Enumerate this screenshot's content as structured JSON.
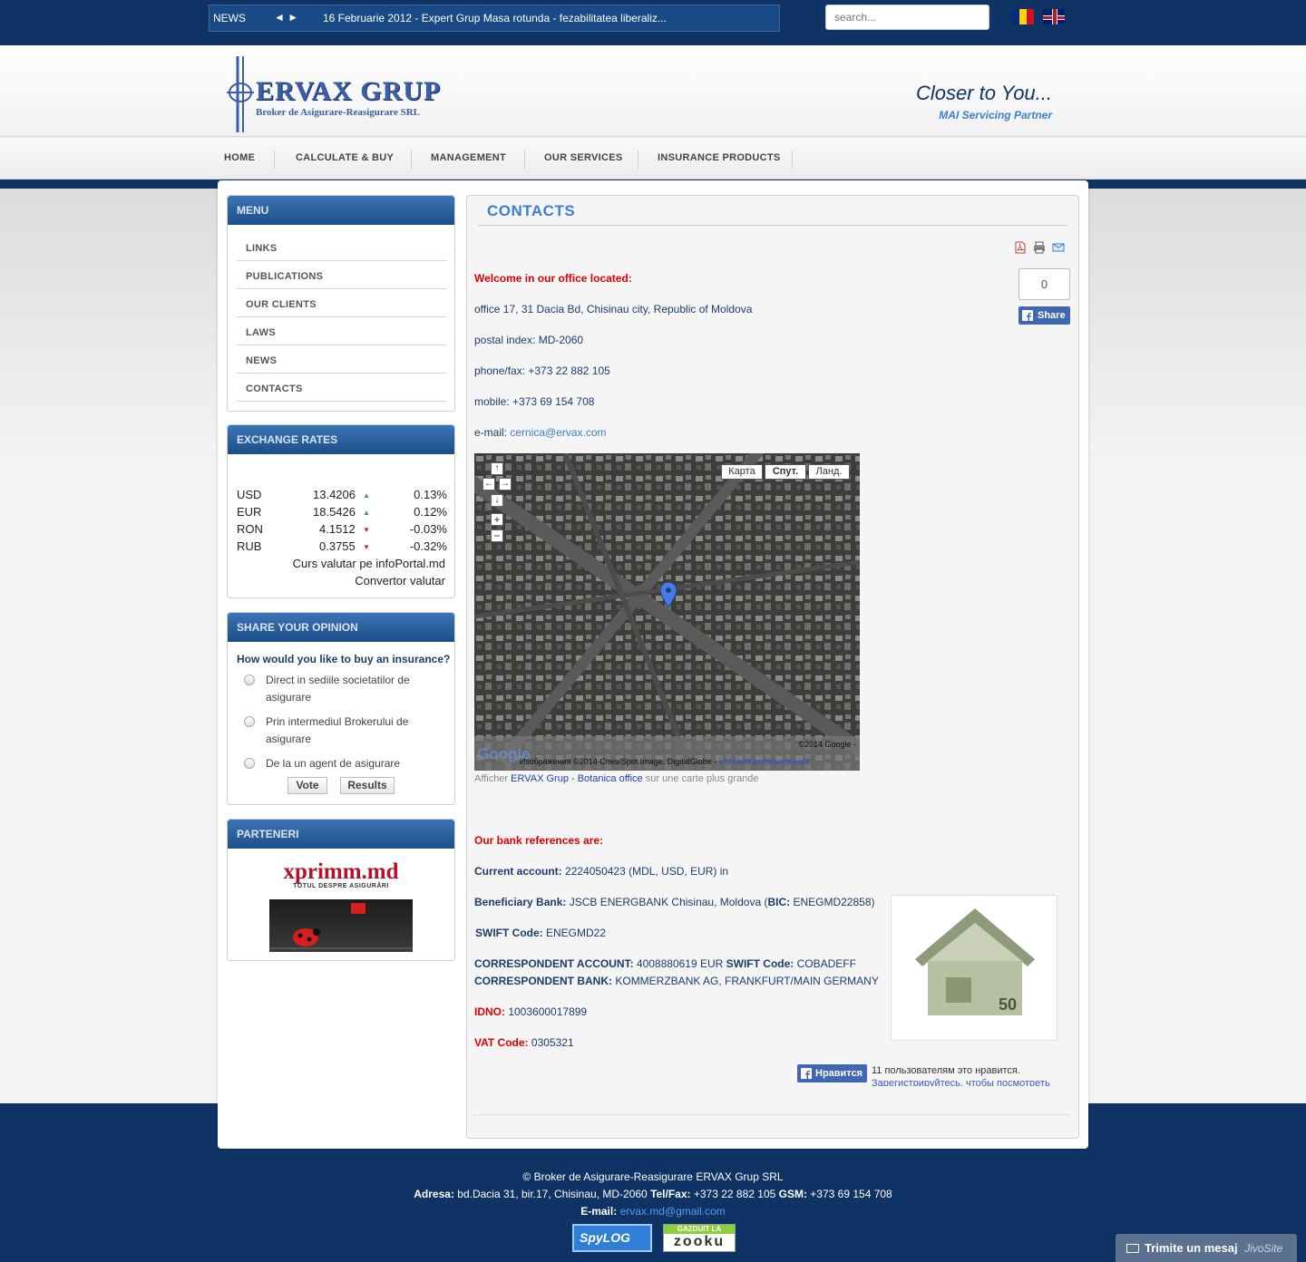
{
  "topbar": {
    "news_label": "NEWS",
    "news_arrows": "◄ ►",
    "news_text": "16 Februarie 2012 - Expert Grup Masa rotunda - fezabilitatea liberaliz...",
    "search_placeholder": "search..."
  },
  "header": {
    "logo_name": "ERVAX GRUP",
    "logo_sub": "Broker de Asigurare-Reasigurare SRL",
    "tagline": "Closer to You...",
    "tagline_sub": "MAI Servicing Partner"
  },
  "nav": [
    "HOME",
    "CALCULATE & BUY",
    "MANAGEMENT",
    "OUR SERVICES",
    "INSURANCE PRODUCTS"
  ],
  "sidebar": {
    "menu_title": "MENU",
    "menu_items": [
      "LINKS",
      "PUBLICATIONS",
      "OUR CLIENTS",
      "LAWS",
      "NEWS",
      "CONTACTS"
    ],
    "rates_title": "EXCHANGE RATES",
    "rates": [
      {
        "code": "USD",
        "value": "13.4206",
        "dir": "▲",
        "change": "0.13%"
      },
      {
        "code": "EUR",
        "value": "18.5426",
        "dir": "▲",
        "change": "0.12%"
      },
      {
        "code": "RON",
        "value": "4.1512",
        "dir": "▼",
        "change": "-0.03%"
      },
      {
        "code": "RUB",
        "value": "0.3755",
        "dir": "▼",
        "change": "-0.32%"
      }
    ],
    "rates_source": "Curs valutar pe infoPortal.md",
    "rates_converter": "Convertor valutar",
    "poll_title": "SHARE YOUR OPINION",
    "poll_question": "How would you like to buy an insurance?",
    "poll_options": [
      "Direct in sediile societatilor de asigurare",
      "Prin intermediul Brokerului de asigurare",
      "De la un agent de asigurare"
    ],
    "vote_label": "Vote",
    "results_label": "Results",
    "partners_title": "PARTENERI",
    "partner1": "xprimm.md",
    "partner1_sub": "TOTUL DESPRE ASIGURĂRI"
  },
  "content": {
    "title": "CONTACTS",
    "share_count": "0",
    "share_label": "Share",
    "welcome": "Welcome in our office located:",
    "address": "office 17, 31 Dacia Bd, Chisinau city, Republic of Moldova",
    "postal": "postal index: MD-2060",
    "phone": "phone/fax: +373 22 882 105",
    "mobile": "mobile: +373 69 154 708",
    "email_label": "e-mail: ",
    "email": "cernica@ervax.com",
    "map_types": [
      "Карта",
      "Спут.",
      "Ланд."
    ],
    "map_copyright": "©2014 Google -",
    "map_credits": "Изображения ©2014 Cnes/Spot Image, DigitalGlobe - ",
    "map_terms": "Условия использования",
    "map_caption_pre": "Afficher ",
    "map_caption_link": "ERVAX Grup - Botanica office",
    "map_caption_post": " sur une carte plus grande",
    "bank_title": "Our bank references are:",
    "current_label": "Current account:",
    "current_value": " 2224050423 (MDL, USD, EUR) in",
    "benef_label": "Beneficiary Bank:",
    "benef_value": " JSCB ENERGBANK Chisinau, Moldova (",
    "bic_label": "BIC:",
    "bic_value": " ENEGMD22858)",
    "swift_label": "SWIFT Code:",
    "swift_value": " ENEGMD22",
    "corr_acc_label": "CORRESPONDENT ACCOUNT:",
    "corr_acc_value": " 4008880619 EUR ",
    "corr_swift_label": "SWIFT Code:",
    "corr_swift_value": " COBADEFF",
    "corr_bank_label": "CORRESPONDENT BANK:",
    "corr_bank_value": " KOMMERZBANK AG, FRANKFURT/MAIN GERMANY",
    "idno_label": "IDNO:",
    "idno_value": " 1003600017899",
    "vat_label": "VAT Code:",
    "vat_value": " 0305321",
    "like_label": "Нравится",
    "like_text": "11 пользователям это нравится.",
    "like_link": "Зарегистрируйтесь, чтобы посмотреть"
  },
  "footer": {
    "copyright": "© Broker de Asigurare-Reasigurare ERVAX Grup SRL",
    "address_label": "Adresa:",
    "address_value": " bd.Dacia 31, bir.17, Chisinau, MD-2060 ",
    "tel_label": "Tel/Fax:",
    "tel_value": " +373 22 882 105 ",
    "gsm_label": "GSM:",
    "gsm_value": " +373 69 154 708",
    "email_label": "E-mail:",
    "email_value": "ervax.md@gmail.com",
    "badge1": "SpyLOG",
    "badge2_top": "GAZDUIT LA",
    "badge2": "zooku",
    "jivo_label": "Trimite un mesaj",
    "jivo_brand": "JivoSite"
  },
  "colors": {
    "navy": "#0e3364",
    "accent": "#3b7fd0",
    "red": "#e40000",
    "facebook": "#4267b2"
  }
}
